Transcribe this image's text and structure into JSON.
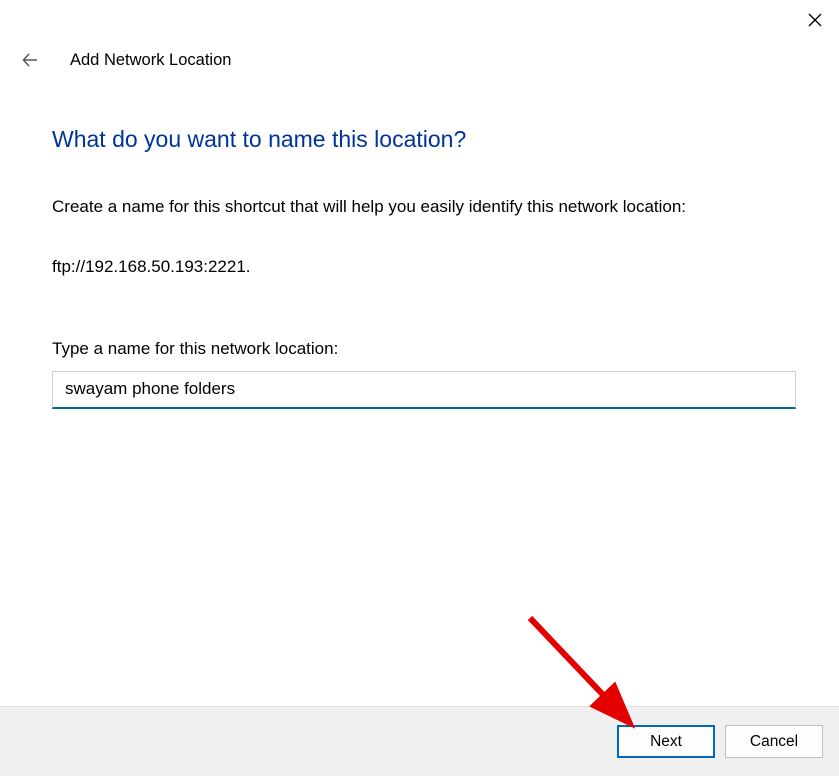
{
  "header": {
    "title": "Add Network Location"
  },
  "main": {
    "heading": "What do you want to name this location?",
    "description": "Create a name for this shortcut that will help you easily identify this network location:",
    "address": "ftp://192.168.50.193:2221.",
    "input_label": "Type a name for this network location:",
    "input_value": "swayam phone folders"
  },
  "buttons": {
    "next": "Next",
    "cancel": "Cancel"
  }
}
